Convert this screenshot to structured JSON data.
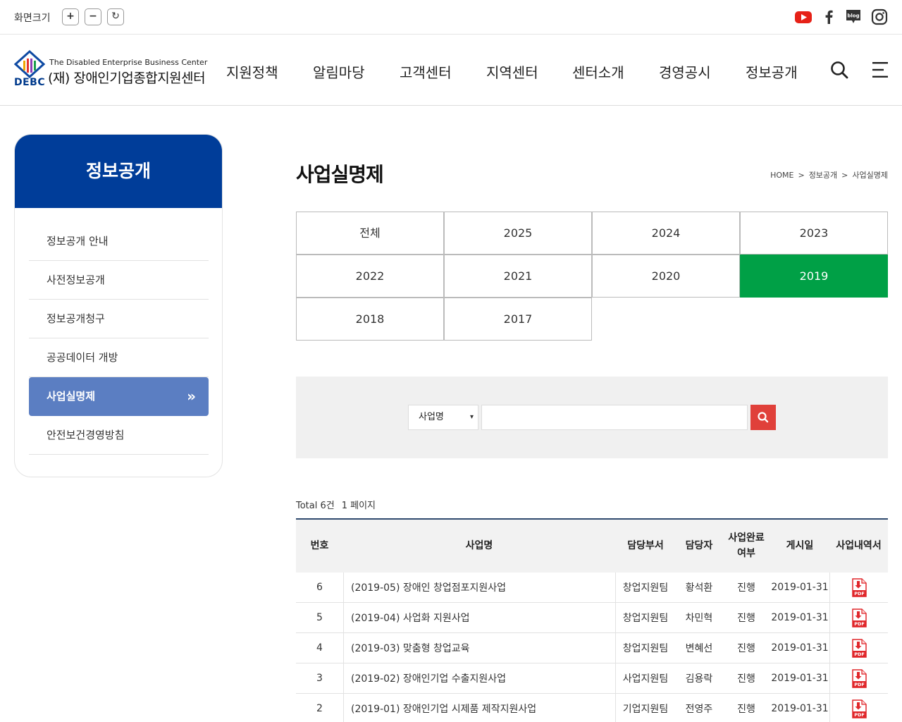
{
  "util": {
    "zoom_label": "화면크기",
    "zoom_in": "+",
    "zoom_out": "−",
    "zoom_reset": "↻"
  },
  "header": {
    "logo_en": "The Disabled Enterprise Business Center",
    "logo_kr": "(재) 장애인기업종합지원센터",
    "logo_abbr": "DEBC",
    "nav": [
      "지원정책",
      "알림마당",
      "고객센터",
      "지역센터",
      "센터소개",
      "경영공시",
      "정보공개"
    ]
  },
  "lnb": {
    "title": "정보공개",
    "items": [
      "정보공개 안내",
      "사전정보공개",
      "정보공개청구",
      "공공데이터 개방",
      "사업실명제",
      "안전보건경영방침"
    ],
    "active_index": 4
  },
  "page": {
    "title": "사업실명제",
    "breadcrumb": [
      "HOME",
      "정보공개",
      "사업실명제"
    ],
    "breadcrumb_sep": ">"
  },
  "years": [
    "전체",
    "2025",
    "2024",
    "2023",
    "2022",
    "2021",
    "2020",
    "2019",
    "2018",
    "2017"
  ],
  "years_active": "2019",
  "search": {
    "select_value": "사업명",
    "input_value": ""
  },
  "summary": {
    "total": "Total 6건",
    "page": "1 페이지"
  },
  "table": {
    "headers": [
      "번호",
      "사업명",
      "담당부서",
      "담당자",
      "사업완료\n여부",
      "게시일",
      "사업내역서"
    ],
    "rows": [
      {
        "no": "6",
        "name": "(2019-05) 장애인 창업점포지원사업",
        "dept": "창업지원팀",
        "manager": "황석환",
        "status": "진행",
        "date": "2019-01-31"
      },
      {
        "no": "5",
        "name": "(2019-04) 사업화 지원사업",
        "dept": "창업지원팀",
        "manager": "차민혁",
        "status": "진행",
        "date": "2019-01-31"
      },
      {
        "no": "4",
        "name": "(2019-03) 맞춤형 창업교육",
        "dept": "창업지원팀",
        "manager": "변혜선",
        "status": "진행",
        "date": "2019-01-31"
      },
      {
        "no": "3",
        "name": "(2019-02) 장애인기업 수출지원사업",
        "dept": "사업지원팀",
        "manager": "김용락",
        "status": "진행",
        "date": "2019-01-31"
      },
      {
        "no": "2",
        "name": "(2019-01) 장애인기업 시제품 제작지원사업",
        "dept": "기업지원팀",
        "manager": "전영주",
        "status": "진행",
        "date": "2019-01-31"
      }
    ],
    "pdf_label": "PDF"
  },
  "icons": {
    "youtube": "youtube-icon",
    "facebook": "facebook-icon",
    "blog": "blog-icon",
    "instagram": "instagram-icon",
    "search": "search-icon",
    "menu": "menu-icon"
  },
  "colors": {
    "brand_blue": "#003d99",
    "active_menu": "#5b7ec2",
    "active_year": "#00a046",
    "search_button": "#e0403a",
    "pdf_red": "#e0262a"
  }
}
